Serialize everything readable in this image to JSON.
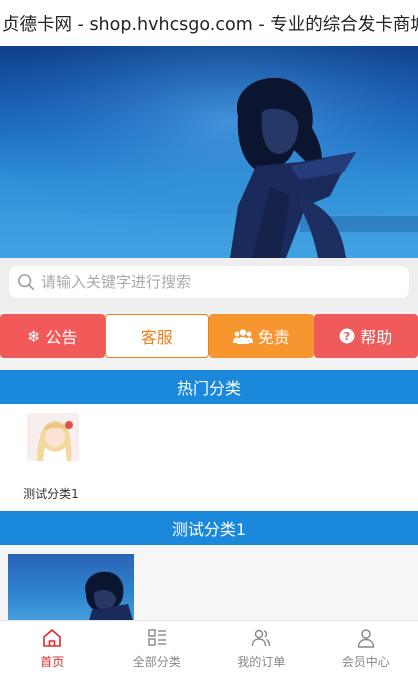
{
  "header": {
    "title": "贞德卡网 - shop.hvhcsgo.com - 专业的综合发卡商城"
  },
  "search": {
    "placeholder": "请输入关键字进行搜索"
  },
  "actions": [
    {
      "label": "公告",
      "icon": "snowflake-icon"
    },
    {
      "label": "客服",
      "icon": ""
    },
    {
      "label": "免责",
      "icon": "users-icon"
    },
    {
      "label": "帮助",
      "icon": "question-circle-icon"
    }
  ],
  "hot_section": {
    "title": "热门分类",
    "items": [
      {
        "label": "测试分类1"
      }
    ]
  },
  "test_section": {
    "title": "测试分类1"
  },
  "bottom_nav": [
    {
      "label": "首页",
      "icon": "home-icon",
      "active": true
    },
    {
      "label": "全部分类",
      "icon": "grid-list-icon",
      "active": false
    },
    {
      "label": "我的订单",
      "icon": "users-icon",
      "active": false
    },
    {
      "label": "会员中心",
      "icon": "user-icon",
      "active": false
    }
  ],
  "colors": {
    "section_blue": "#1b89db",
    "red": "#f25a5a",
    "orange": "#f7952f",
    "active_nav": "#e02828"
  }
}
